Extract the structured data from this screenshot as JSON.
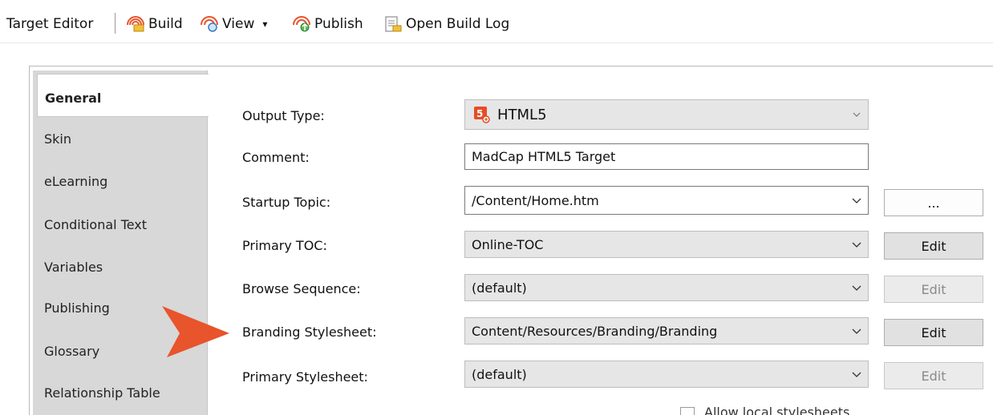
{
  "toolbar": {
    "title": "Target Editor",
    "build": "Build",
    "view": "View",
    "view_caret": "▾",
    "publish": "Publish",
    "open_build_log": "Open Build Log"
  },
  "tabs": [
    "General",
    "Skin",
    "eLearning",
    "Conditional Text",
    "Variables",
    "Publishing",
    "Glossary",
    "Relationship Table"
  ],
  "form": {
    "output_type": {
      "label": "Output Type:",
      "value": "HTML5"
    },
    "comment": {
      "label": "Comment:",
      "value": "MadCap HTML5 Target"
    },
    "startup_topic": {
      "label": "Startup Topic:",
      "value": "/Content/Home.htm",
      "button": "..."
    },
    "primary_toc": {
      "label": "Primary TOC:",
      "value": "Online-TOC",
      "button": "Edit"
    },
    "browse_sequence": {
      "label": "Browse Sequence:",
      "value": "(default)",
      "button": "Edit"
    },
    "branding_stylesheet": {
      "label": "Branding Stylesheet:",
      "value": "Content/Resources/Branding/Branding",
      "button": "Edit"
    },
    "primary_stylesheet": {
      "label": "Primary Stylesheet:",
      "value": "(default)",
      "button": "Edit"
    },
    "allow_local": {
      "label": "Allow local stylesheets",
      "checked": false
    }
  },
  "colors": {
    "accent_arrow": "#e8542c",
    "html5_icon": "#e44d26"
  },
  "icons": [
    "build-icon",
    "view-icon",
    "publish-icon",
    "open-build-log-icon",
    "html5-icon",
    "chevron-down-icon"
  ]
}
